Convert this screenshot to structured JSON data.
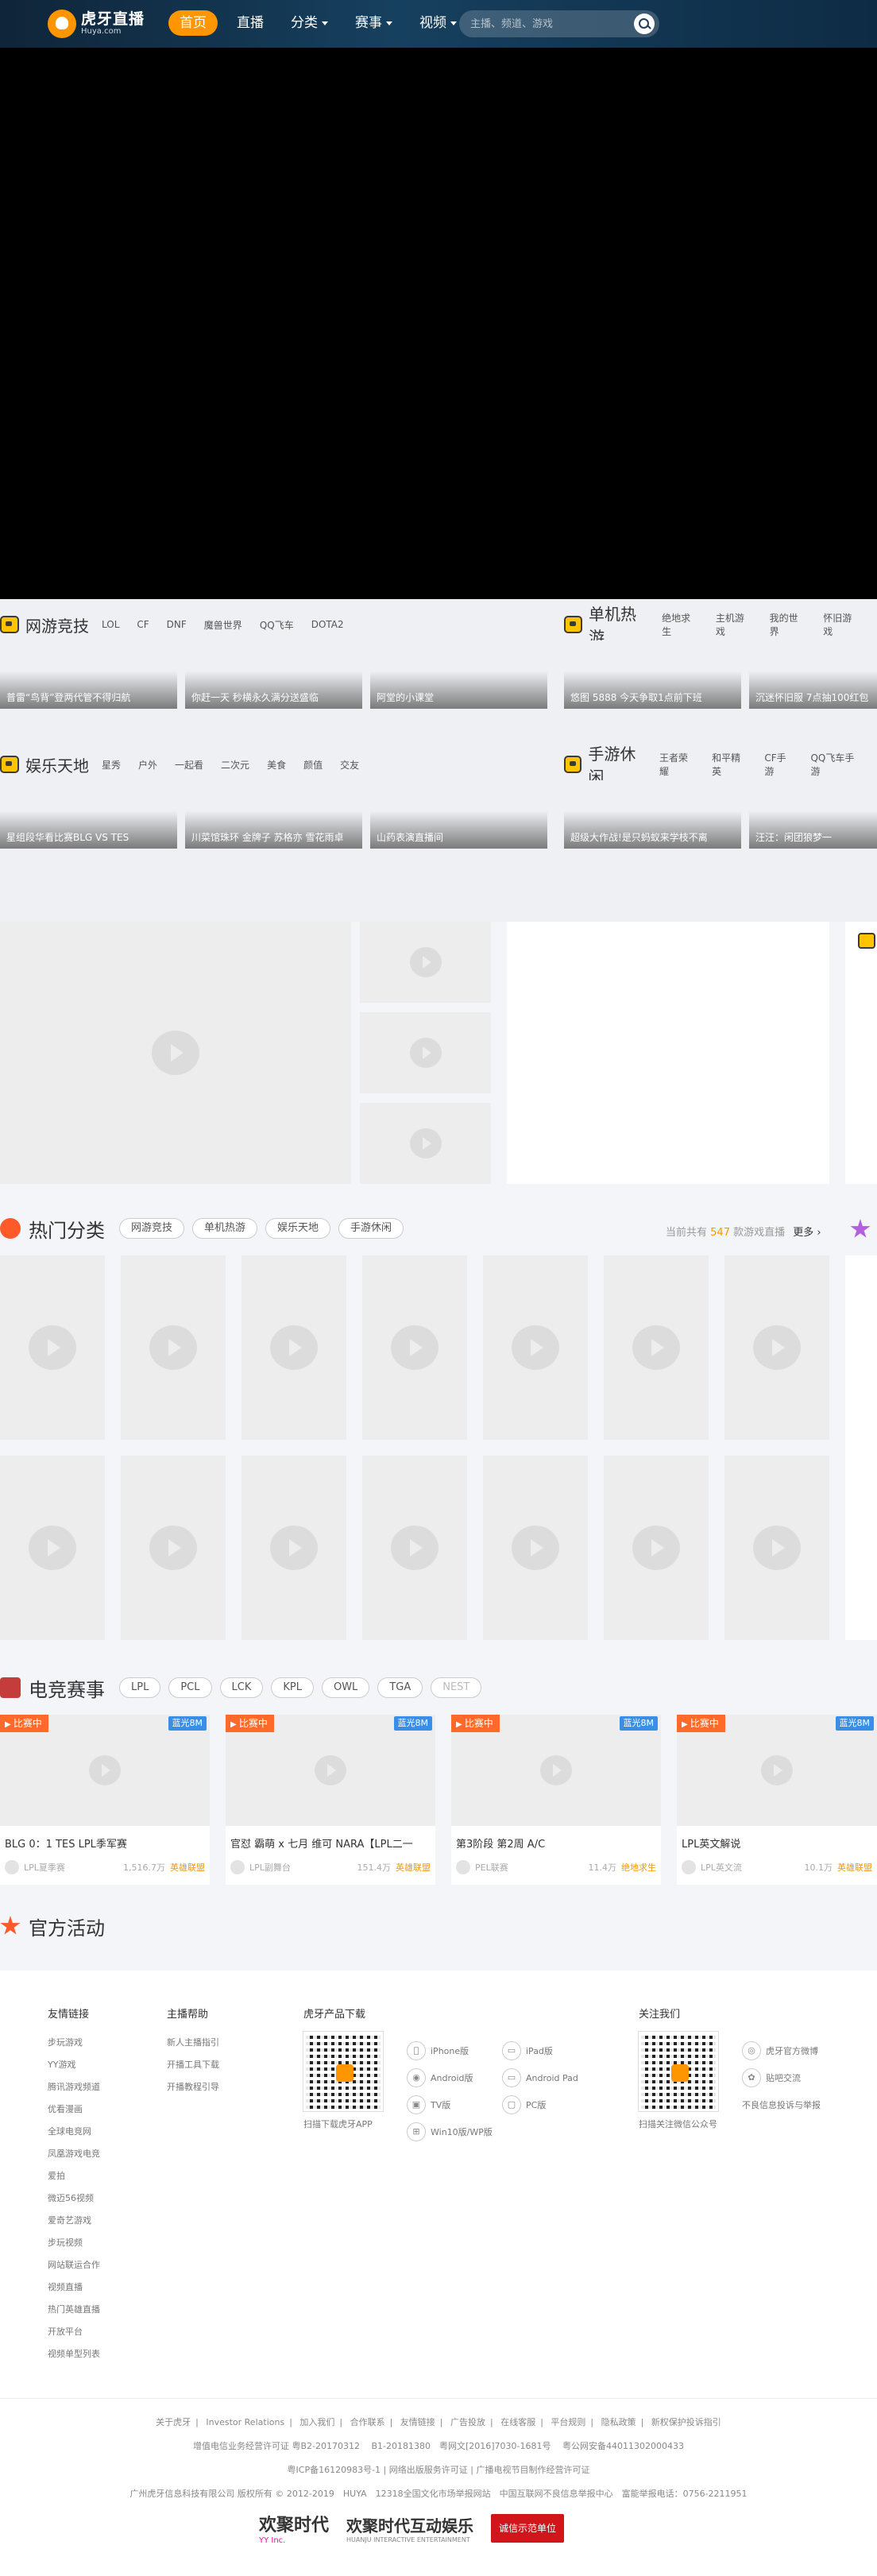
{
  "header": {
    "logo_cn": "虎牙直播",
    "logo_en": "Huya.com",
    "nav": [
      {
        "label": "首页",
        "active": true
      },
      {
        "label": "直播"
      },
      {
        "label": "分类"
      },
      {
        "label": "赛事"
      },
      {
        "label": "视频"
      }
    ],
    "search_placeholder": "主播、频道、游戏"
  },
  "categories": {
    "wangyou": {
      "title": "网游竞技",
      "tags": [
        "LOL",
        "CF",
        "DNF",
        "魔兽世界",
        "QQ飞车",
        "DOTA2"
      ],
      "thumbs": [
        "普雷“鸟背”登两代管不得归航",
        "你赶一天 秒横永久满分送盛临",
        "阿堂的小课堂"
      ]
    },
    "danji": {
      "title": "单机热游",
      "tags": [
        "绝地求生",
        "主机游戏",
        "我的世界",
        "怀旧游戏"
      ],
      "thumbs": [
        "悠图 5888 今天争取1点前下班",
        "沉迷怀旧服 7点抽100红包"
      ]
    },
    "yule": {
      "title": "娱乐天地",
      "tags": [
        "星秀",
        "户外",
        "一起看",
        "二次元",
        "美食",
        "颜值",
        "交友"
      ],
      "thumbs": [
        "星组段华看比赛BLG VS TES",
        "川菜馆珠环 金牌子 苏格亦 雪花雨卓",
        "山药表演直播间"
      ]
    },
    "shouyou": {
      "title": "手游休闲",
      "tags": [
        "王者荣耀",
        "和平精英",
        "CF手游",
        "QQ飞车手游"
      ],
      "thumbs": [
        "超级大作战!是只蚂蚁来学枝不离",
        "汪汪：闲团狼梦一"
      ]
    }
  },
  "hot": {
    "title": "热门分类",
    "tabs": [
      "网游竞技",
      "单机热游",
      "娱乐天地",
      "手游休闲"
    ],
    "count_prefix": "当前共有",
    "count": "547",
    "count_suffix": "款游戏直播",
    "more": "更多"
  },
  "esports": {
    "title": "电竞赛事",
    "tabs": [
      "LPL",
      "PCL",
      "LCK",
      "KPL",
      "OWL",
      "TGA",
      "NEST"
    ],
    "cards": [
      {
        "live": "比赛中",
        "hd": "蓝光8M",
        "title": "BLG 0：1 TES LPL季军赛",
        "streamer": "LPL夏季赛",
        "views": "1,516.7万",
        "cat": "英雄联盟"
      },
      {
        "live": "比赛中",
        "hd": "蓝光8M",
        "title": "官怼 霸萌 x 七月 维可 NARA【LPL二一",
        "streamer": "LPL副舞台",
        "views": "151.4万",
        "cat": "英雄联盟"
      },
      {
        "live": "比赛中",
        "hd": "蓝光8M",
        "title": "第3阶段 第2周 A/C",
        "streamer": "PEL联赛",
        "views": "11.4万",
        "cat": "绝地求生"
      },
      {
        "live": "比赛中",
        "hd": "蓝光8M",
        "title": "LPL英文解说",
        "streamer": "LPL英文流",
        "views": "10.1万",
        "cat": "英雄联盟"
      }
    ]
  },
  "activity": {
    "title": "官方活动"
  },
  "footer": {
    "friend_title": "友情链接",
    "friend_links": [
      "步玩游戏",
      "YY游戏",
      "腾讯游戏频道",
      "优看漫画",
      "全球电竞网",
      "凤凰游戏电竞",
      "爱拍",
      "微迈56视频",
      "爱奇艺游戏",
      "步玩视频",
      "网站联运合作",
      "视频直播",
      "热门英雄直播",
      "开放平台",
      "视频单型列表"
    ],
    "help_title": "主播帮助",
    "help_links": [
      "新人主播指引",
      "开播工具下载",
      "开播教程引导"
    ],
    "download_title": "虎牙产品下载",
    "download_qr_caption": "扫描下载虎牙APP",
    "download_items": [
      "iPhone版",
      "iPad版",
      "Android版",
      "Android Pad",
      "TV版",
      "PC版",
      "Win10版/WP版"
    ],
    "follow_title": "关注我们",
    "follow_qr_caption": "扫描关注微信公众号",
    "follow_items": [
      "虎牙官方微博",
      "贴吧交流",
      "不良信息投诉与举报"
    ],
    "links_line": [
      "关于虎牙",
      "Investor Relations",
      "加入我们",
      "合作联系",
      "友情链接",
      "广告投放",
      "在线客服",
      "平台规则",
      "隐私政策",
      "新权保护投诉指引"
    ],
    "line2": "增值电信业务经营许可证 粤B2-20170312 　B1-20181380　粤网文[2016]7030-1681号　 粤公网安备44011302000433",
    "line3": "粤ICP备16120983号-1 | 网络出版服务许可证 | 广播电视节目制作经营许可证",
    "line4": "广州虎牙信息科技有限公司 版权所有 © 2012-2019　HUYA　12318全国文化市场举报网站　中国互联网不良信息举报中心　富能举报电话：0756-2211951",
    "logo_yy": "欢聚时代",
    "logo_yy_en": "YY Inc.",
    "logo_hj": "欢聚时代互动娱乐",
    "logo_hj_en": "HUANJU INTERACTIVE ENTERTAINMENT",
    "logo_cx": "诚信示范单位"
  }
}
